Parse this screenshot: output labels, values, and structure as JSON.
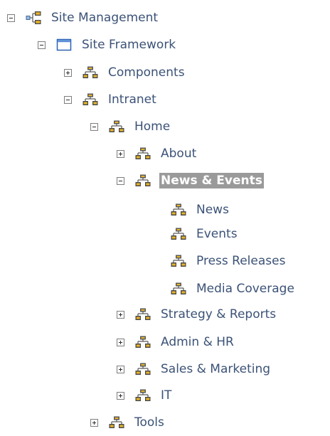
{
  "tree": {
    "root": {
      "label": "Site Management",
      "icon": "site-hierarchy-icon",
      "expanded": true
    },
    "framework": {
      "label": "Site Framework",
      "icon": "window-icon",
      "expanded": true
    },
    "components": {
      "label": "Components",
      "icon": "org-chart-icon",
      "expanded": false
    },
    "intranet": {
      "label": "Intranet",
      "icon": "org-chart-icon",
      "expanded": true
    },
    "home": {
      "label": "Home",
      "icon": "org-chart-icon",
      "expanded": true
    },
    "about": {
      "label": "About",
      "icon": "org-chart-icon",
      "expanded": false
    },
    "news_events": {
      "label": "News & Events",
      "icon": "org-chart-icon",
      "expanded": true,
      "selected": true
    },
    "news": {
      "label": "News",
      "icon": "org-chart-icon"
    },
    "events": {
      "label": "Events",
      "icon": "org-chart-icon"
    },
    "press_releases": {
      "label": "Press Releases",
      "icon": "org-chart-icon"
    },
    "media_coverage": {
      "label": "Media Coverage",
      "icon": "org-chart-icon"
    },
    "strategy_reports": {
      "label": "Strategy & Reports",
      "icon": "org-chart-icon",
      "expanded": false
    },
    "admin_hr": {
      "label": "Admin & HR",
      "icon": "org-chart-icon",
      "expanded": false
    },
    "sales_marketing": {
      "label": "Sales & Marketing",
      "icon": "org-chart-icon",
      "expanded": false
    },
    "it": {
      "label": "IT",
      "icon": "org-chart-icon",
      "expanded": false
    },
    "tools": {
      "label": "Tools",
      "icon": "org-chart-icon",
      "expanded": false
    }
  },
  "colors": {
    "text": "#3b5277",
    "selected_background": "#9a9a9a",
    "selected_text": "#ffffff",
    "icon_gold": "#e8b428",
    "icon_dark": "#4a4a4a"
  }
}
